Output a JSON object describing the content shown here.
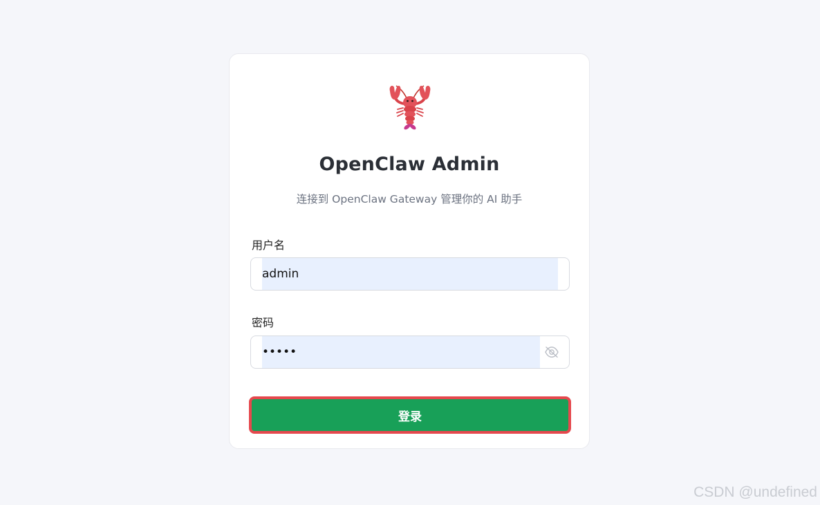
{
  "login": {
    "title": "OpenClaw Admin",
    "subtitle": "连接到 OpenClaw Gateway 管理你的 AI 助手",
    "username_label": "用户名",
    "username_value": "admin",
    "password_label": "密码",
    "password_value": "admin",
    "submit_label": "登录"
  },
  "icons": {
    "logo": "lobster-icon",
    "password_toggle": "eye-off-icon"
  },
  "colors": {
    "background": "#f5f6fa",
    "primary_button": "#18a058",
    "button_highlight_border": "#e5484d",
    "autofill_background": "#e8f0fe"
  },
  "watermark": "CSDN @undefined"
}
